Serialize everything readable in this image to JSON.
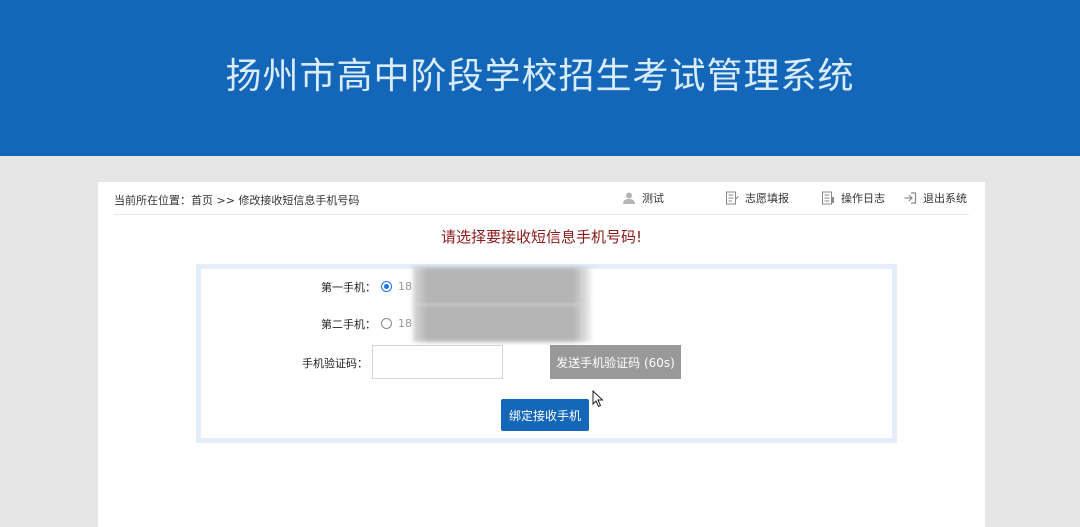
{
  "header": {
    "title": "扬州市高中阶段学校招生考试管理系统"
  },
  "breadcrumb": {
    "prefix": "当前所在位置：",
    "home": "首页",
    "separator": ">>",
    "current": "修改接收短信息手机号码"
  },
  "topnav": {
    "user": {
      "label": "测试",
      "icon": "user-icon"
    },
    "items": [
      {
        "label": "志愿填报",
        "icon": "form-icon"
      },
      {
        "label": "操作日志",
        "icon": "log-icon"
      },
      {
        "label": "退出系统",
        "icon": "logout-icon"
      }
    ]
  },
  "notice": "请选择要接收短信息手机号码!",
  "form": {
    "phone1": {
      "label": "第一手机：",
      "prefix": "18",
      "checked": true
    },
    "phone2": {
      "label": "第二手机：",
      "prefix": "18",
      "checked": false
    },
    "code": {
      "label": "手机验证码：",
      "value": "",
      "placeholder": ""
    },
    "send_button": "发送手机验证码 (60s)",
    "bind_button": "绑定接收手机"
  },
  "colors": {
    "header_bg": "#1466b8",
    "notice": "#8b1a1a",
    "send_button_bg": "#999999",
    "bind_button_bg": "#1466b8"
  }
}
